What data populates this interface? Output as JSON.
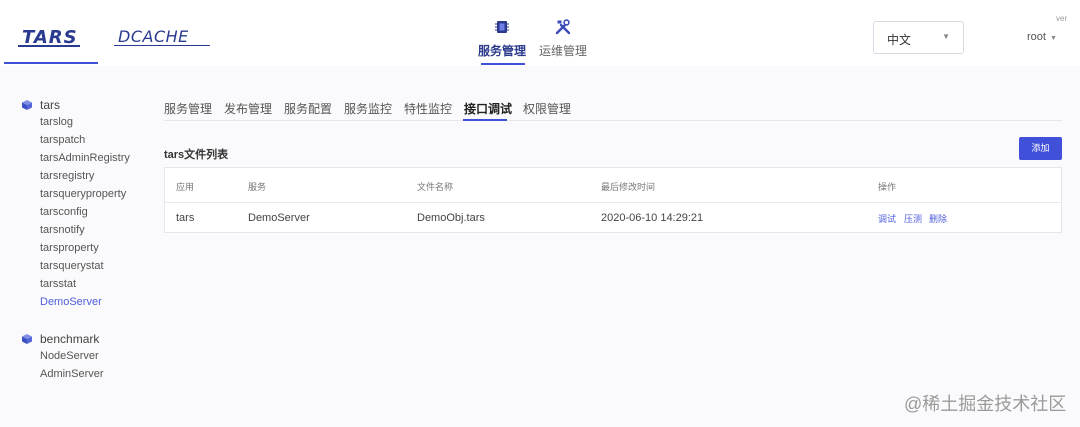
{
  "header": {
    "logos": {
      "tars": "TARS",
      "dcache": "DCACHE"
    },
    "nav": [
      {
        "label": "服务管理",
        "icon": "chip-icon",
        "active": true
      },
      {
        "label": "运维管理",
        "icon": "tools-icon",
        "active": false
      }
    ],
    "language": {
      "value": "中文"
    },
    "user": {
      "name": "root"
    },
    "version": "ver"
  },
  "sidebar": {
    "groups": [
      {
        "title": "tars",
        "icon": "cube-icon",
        "items": [
          "tarslog",
          "tarspatch",
          "tarsAdminRegistry",
          "tarsregistry",
          "tarsqueryproperty",
          "tarsconfig",
          "tarsnotify",
          "tarsproperty",
          "tarsquerystat",
          "tarsstat",
          "DemoServer"
        ],
        "selected": "DemoServer"
      },
      {
        "title": "benchmark",
        "icon": "cube-icon",
        "items": [
          "NodeServer",
          "AdminServer"
        ]
      }
    ]
  },
  "tabs": [
    "服务管理",
    "发布管理",
    "服务配置",
    "服务监控",
    "特性监控",
    "接口调试",
    "权限管理"
  ],
  "active_tab": "接口调试",
  "section": {
    "title": "tars文件列表",
    "add_label": "添加"
  },
  "table": {
    "columns": [
      "应用",
      "服务",
      "文件名称",
      "最后修改时间",
      "操作"
    ],
    "rows": [
      {
        "app": "tars",
        "server": "DemoServer",
        "file": "DemoObj.tars",
        "modified": "2020-06-10 14:29:21",
        "actions": [
          "调试",
          "压测",
          "删除"
        ]
      }
    ]
  },
  "watermark": "@稀土掘金技术社区",
  "colors": {
    "accent": "#4150d8",
    "brand": "#2a3a8f",
    "link": "#4f5fdc"
  }
}
